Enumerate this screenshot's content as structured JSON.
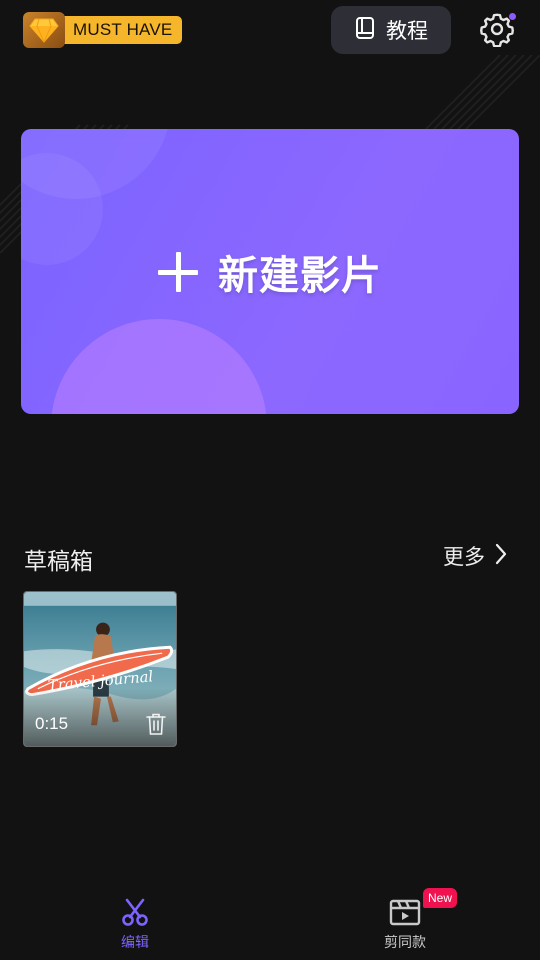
{
  "header": {
    "vip_label": "MUST HAVE",
    "tutorial_label": "教程",
    "icons": {
      "vip": "diamond-icon",
      "tutorial": "book-icon",
      "settings": "gear-icon"
    },
    "settings_has_notification": true
  },
  "banner": {
    "label": "新建影片",
    "icon": "plus-icon"
  },
  "drafts": {
    "title": "草稿箱",
    "more_label": "更多",
    "items": [
      {
        "duration": "0:15",
        "overlay_text": "Travel journal"
      }
    ]
  },
  "bottom_nav": {
    "tabs": [
      {
        "label": "编辑",
        "icon": "scissors-icon",
        "active": true
      },
      {
        "label": "剪同款",
        "icon": "clapperboard-icon",
        "active": false,
        "badge": "New"
      }
    ]
  },
  "colors": {
    "background": "#121212",
    "accent": "#7d63ff",
    "vip_gold": "#f5b62b",
    "badge_red": "#f0124f"
  }
}
